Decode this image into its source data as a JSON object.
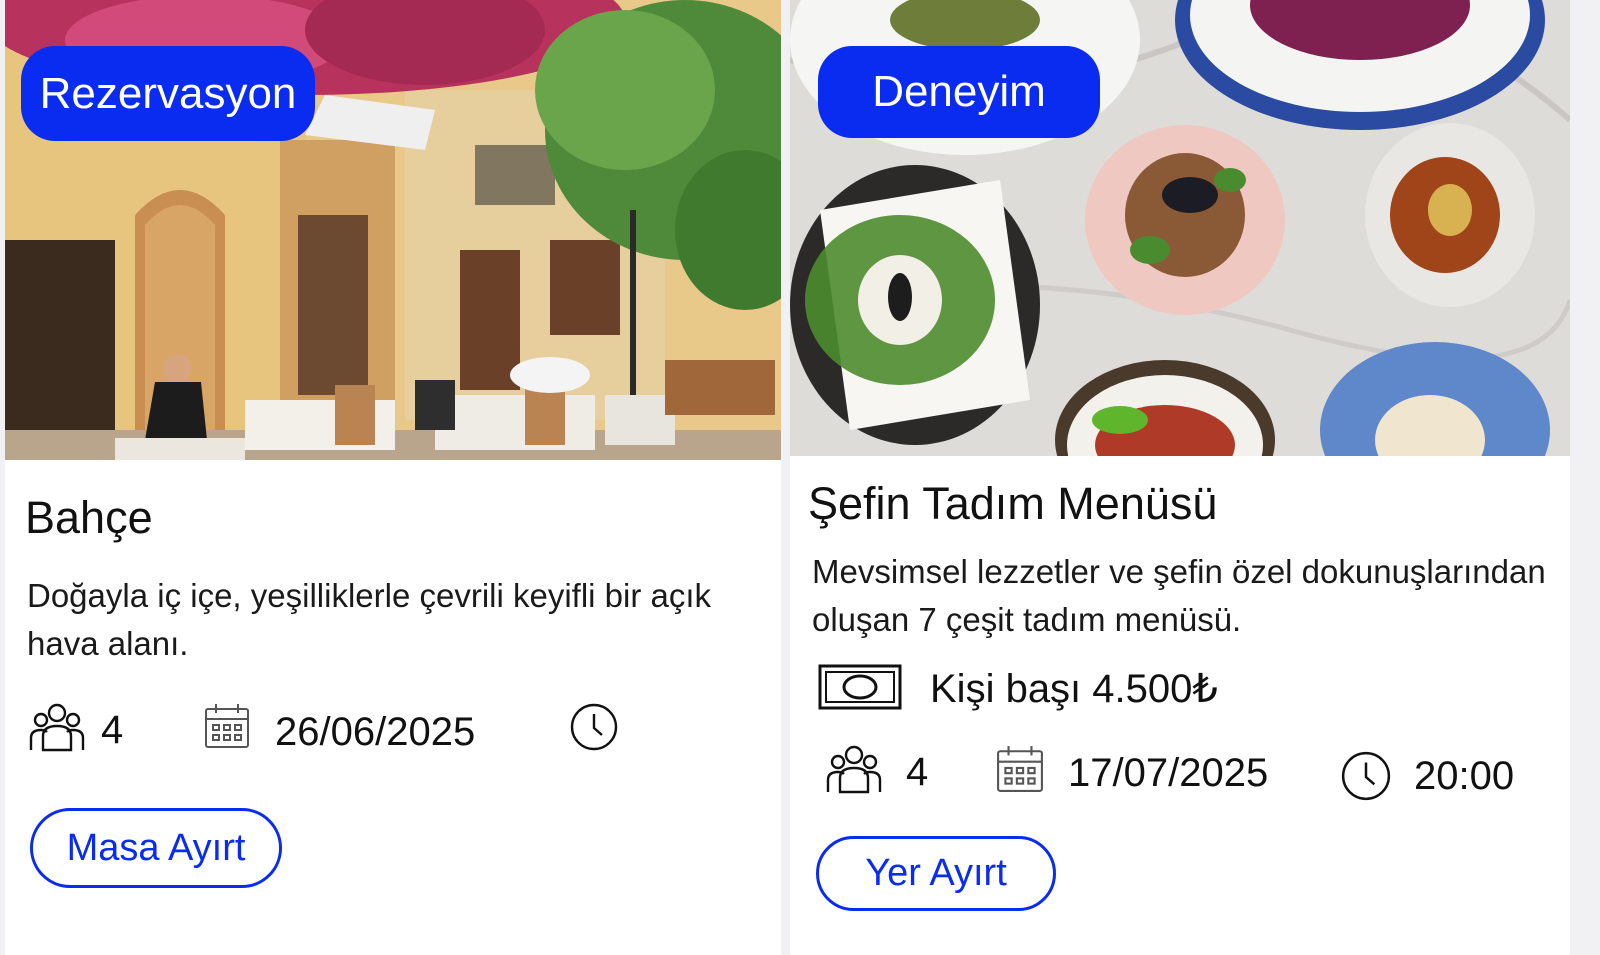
{
  "cards": [
    {
      "badge": "Rezervasyon",
      "title": "Bahçe",
      "description": "Doğayla iç içe, yeşilliklerle çevrili keyifli bir açık hava alanı.",
      "guests": "4",
      "date": "26/06/2025",
      "time": "",
      "button": "Masa Ayırt",
      "icons": [
        "people-icon",
        "calendar-icon",
        "clock-icon"
      ]
    },
    {
      "badge": "Deneyim",
      "title": "Şefin Tadım Menüsü",
      "description": "Mevsimsel lezzetler ve şefin özel dokunuşlarından oluşan 7 çeşit tadım menüsü.",
      "price": "Kişi başı 4.500₺",
      "guests": "4",
      "date": "17/07/2025",
      "time": "20:00",
      "button": "Yer Ayırt",
      "icons": [
        "money-icon",
        "people-icon",
        "calendar-icon",
        "clock-icon"
      ]
    }
  ],
  "colors": {
    "accent": "#0a2bf0",
    "card": "#ffffff",
    "background": "#f1f1f3"
  }
}
